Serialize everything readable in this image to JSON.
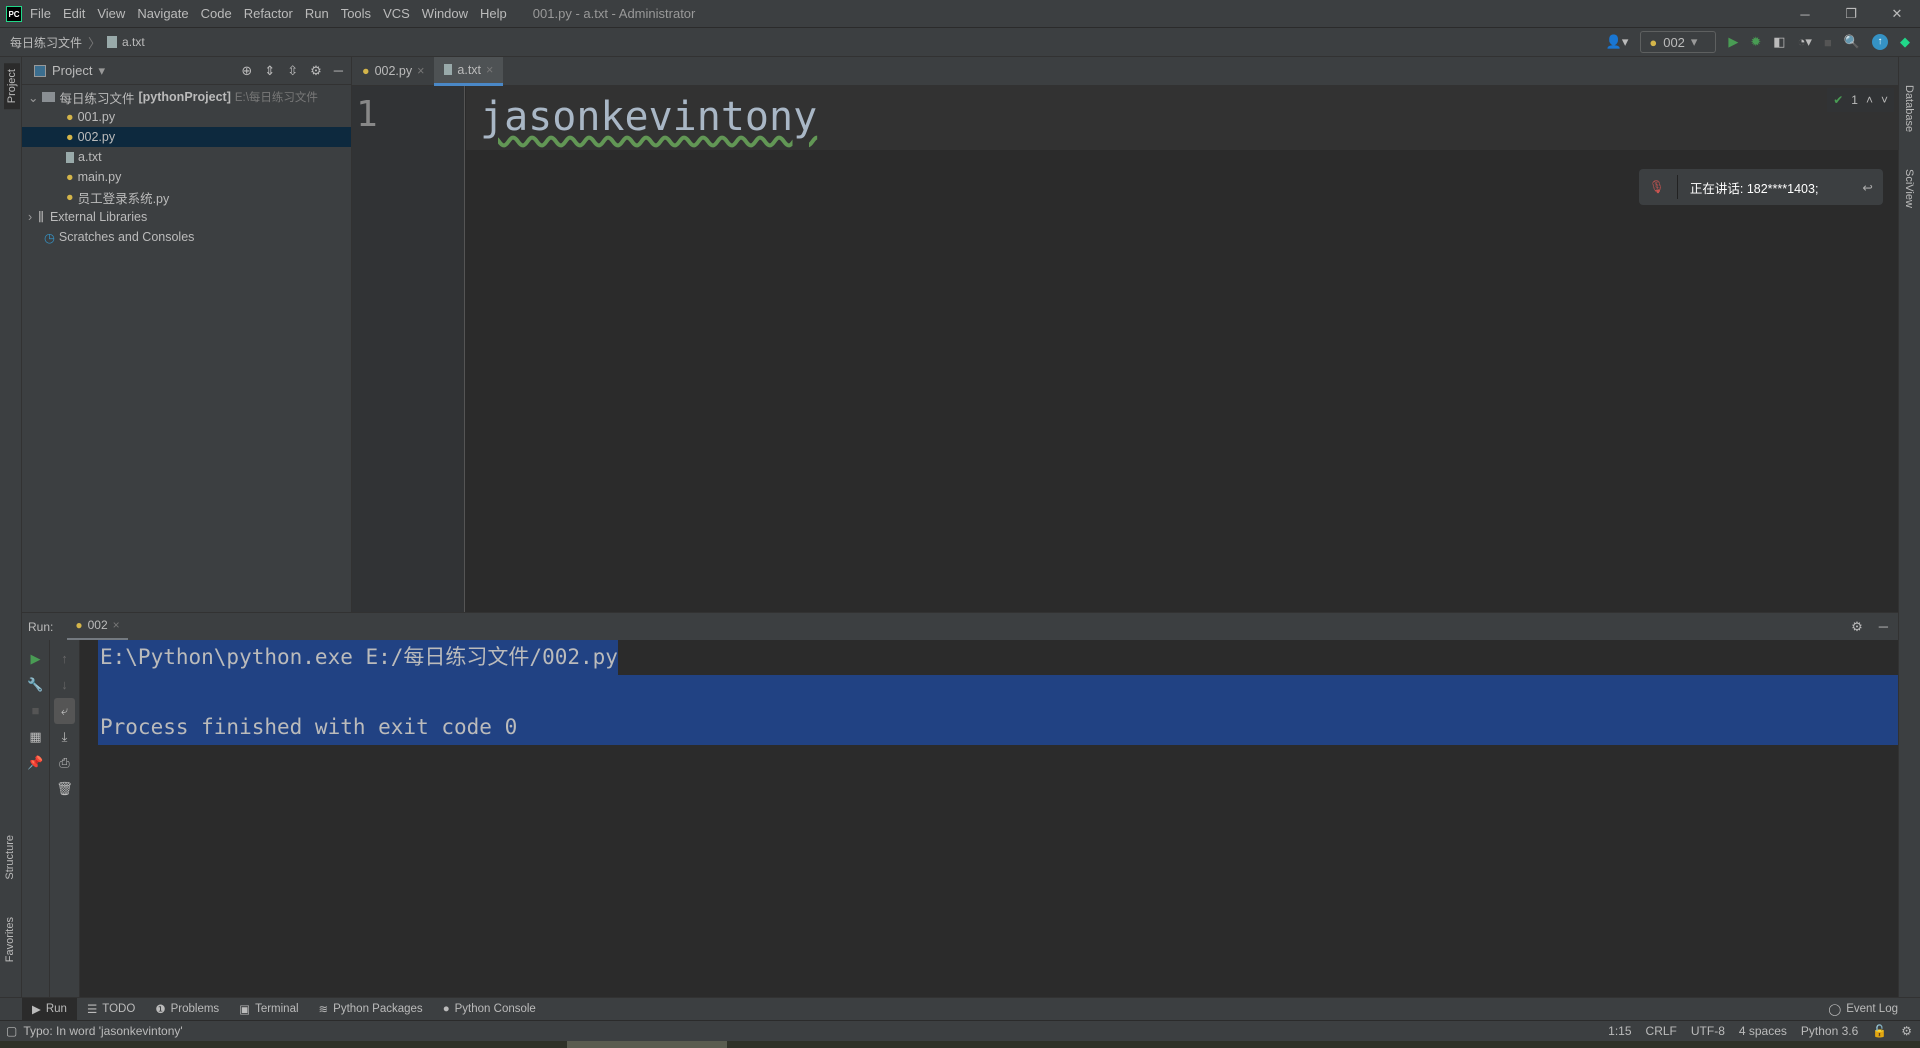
{
  "window": {
    "title": "001.py - a.txt - Administrator",
    "logo": "PC"
  },
  "menu": [
    "File",
    "Edit",
    "View",
    "Navigate",
    "Code",
    "Refactor",
    "Run",
    "Tools",
    "VCS",
    "Window",
    "Help"
  ],
  "breadcrumb": {
    "folder": "每日练习文件",
    "file": "a.txt"
  },
  "run_config": "002",
  "project_panel": {
    "title": "Project",
    "root": {
      "name": "每日练习文件",
      "project": "[pythonProject]",
      "path": "E:\\每日练习文件"
    },
    "files": [
      {
        "name": "001.py",
        "icon": "python-file"
      },
      {
        "name": "002.py",
        "icon": "python-file",
        "selected": true
      },
      {
        "name": "a.txt",
        "icon": "text-file"
      },
      {
        "name": "main.py",
        "icon": "python-file"
      },
      {
        "name": "员工登录系统.py",
        "icon": "python-file"
      }
    ],
    "external": "External Libraries",
    "scratches": "Scratches and Consoles"
  },
  "left_stripe": {
    "project": "Project",
    "structure": "Structure",
    "favorites": "Favorites"
  },
  "right_stripe": {
    "database": "Database",
    "sciview": "SciView"
  },
  "editor_tabs": [
    {
      "label": "002.py",
      "active": false
    },
    {
      "label": "a.txt",
      "active": true
    }
  ],
  "editor": {
    "line_number": "1",
    "content": "jasonkevintony",
    "inspection_count": "1"
  },
  "notification": {
    "text": "正在讲话: 182****1403;"
  },
  "run": {
    "label": "Run:",
    "tab": "002",
    "lines": [
      "E:\\Python\\python.exe E:/每日练习文件/002.py",
      "",
      "Process finished with exit code 0"
    ]
  },
  "tool_windows": [
    "Run",
    "TODO",
    "Problems",
    "Terminal",
    "Python Packages",
    "Python Console"
  ],
  "event_log": "Event Log",
  "status": {
    "message": "Typo: In word 'jasonkevintony'",
    "position": "1:15",
    "line_sep": "CRLF",
    "encoding": "UTF-8",
    "indent": "4 spaces",
    "interpreter": "Python 3.6"
  },
  "colors": {
    "accent": "#4a88c7",
    "selection": "#214283",
    "run_green": "#499c54"
  }
}
